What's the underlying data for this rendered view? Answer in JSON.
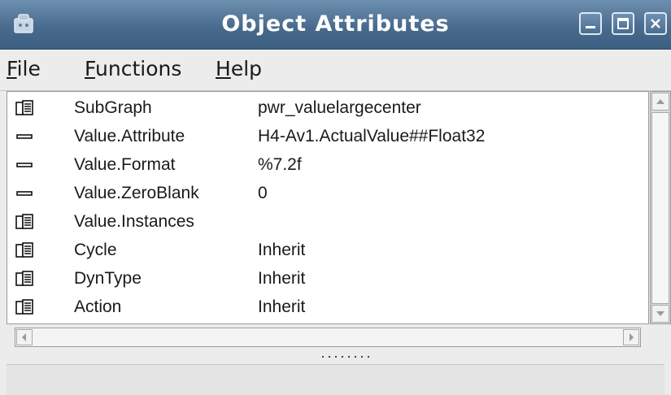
{
  "window": {
    "title": "Object Attributes",
    "controls": [
      "minimize-icon",
      "maximize-icon",
      "close-icon"
    ]
  },
  "menu": {
    "file": {
      "accel": "F",
      "rest": "ile"
    },
    "functions": {
      "accel": "F",
      "rest": "unctions"
    },
    "help": {
      "accel": "H",
      "rest": "elp"
    }
  },
  "attributes": [
    {
      "name": "SubGraph",
      "value": "pwr_valuelargecenter",
      "icon": "folder-icon"
    },
    {
      "name": "Value.Attribute",
      "value": "H4-Av1.ActualValue##Float32",
      "icon": "attribute-icon"
    },
    {
      "name": "Value.Format",
      "value": "%7.2f",
      "icon": "attribute-icon"
    },
    {
      "name": "Value.ZeroBlank",
      "value": "0",
      "icon": "attribute-icon"
    },
    {
      "name": "Value.Instances",
      "value": "",
      "icon": "folder-icon"
    },
    {
      "name": "Cycle",
      "value": "Inherit",
      "icon": "folder-icon"
    },
    {
      "name": "DynType",
      "value": "Inherit",
      "icon": "folder-icon"
    },
    {
      "name": "Action",
      "value": "Inherit",
      "icon": "folder-icon"
    }
  ],
  "colors": {
    "titlebar": "#46698c",
    "title_text": "#ffffff",
    "list_background": "#ffffff",
    "window_background": "#ececec"
  }
}
